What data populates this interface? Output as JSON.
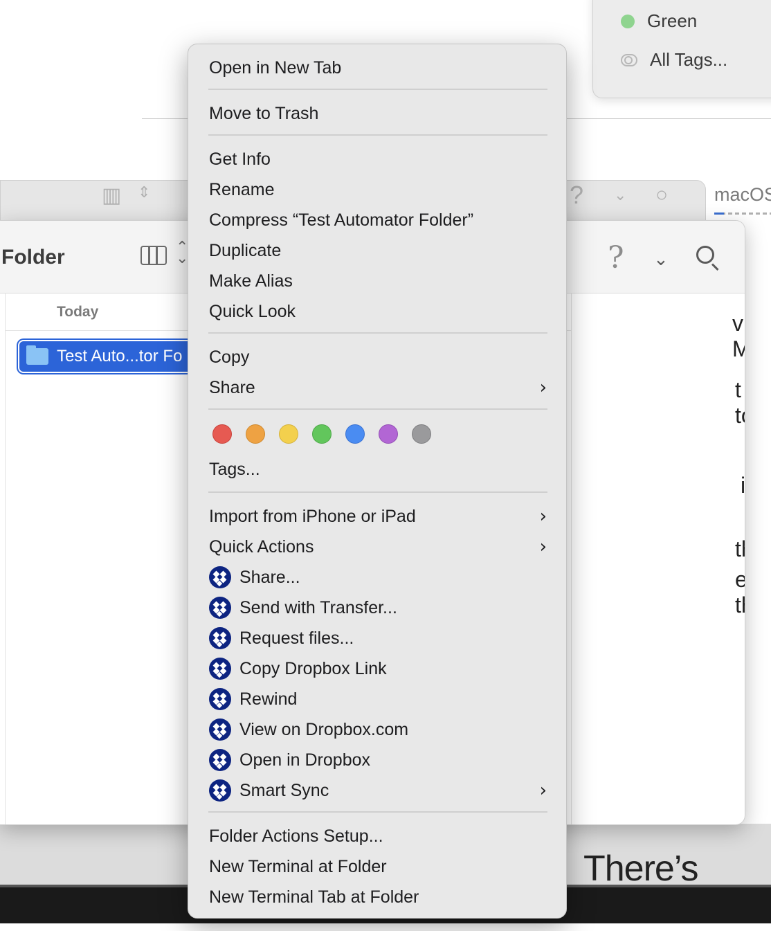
{
  "background": {
    "tag_popup": {
      "green_label": "Green",
      "all_tags_label": "All Tags..."
    },
    "right_label": "macOS",
    "fragments": [
      "v M",
      "t to",
      "in",
      "the",
      "e th"
    ],
    "tagline": "There’s more"
  },
  "finder": {
    "title": "Folder",
    "column_header": "Today",
    "selected_item": "Test Auto...tor Fo"
  },
  "context_menu": {
    "items": [
      "Open in New Tab",
      "Move to Trash",
      "Get Info",
      "Rename",
      "Compress “Test Automator Folder”",
      "Duplicate",
      "Make Alias",
      "Quick Look",
      "Copy",
      "Share",
      "Tags...",
      "Import from iPhone or iPad",
      "Quick Actions"
    ],
    "tag_colors": [
      "#e65a52",
      "#eea243",
      "#f3d04d",
      "#62c65c",
      "#4a8cf2",
      "#b266d4",
      "#9a9a9c"
    ],
    "dropbox_items": [
      "Share...",
      "Send with Transfer...",
      "Request files...",
      "Copy Dropbox Link",
      "Rewind",
      "View on Dropbox.com",
      "Open in Dropbox",
      "Smart Sync"
    ],
    "footer_items": [
      "Folder Actions Setup...",
      "New Terminal at Folder",
      "New Terminal Tab at Folder"
    ]
  }
}
